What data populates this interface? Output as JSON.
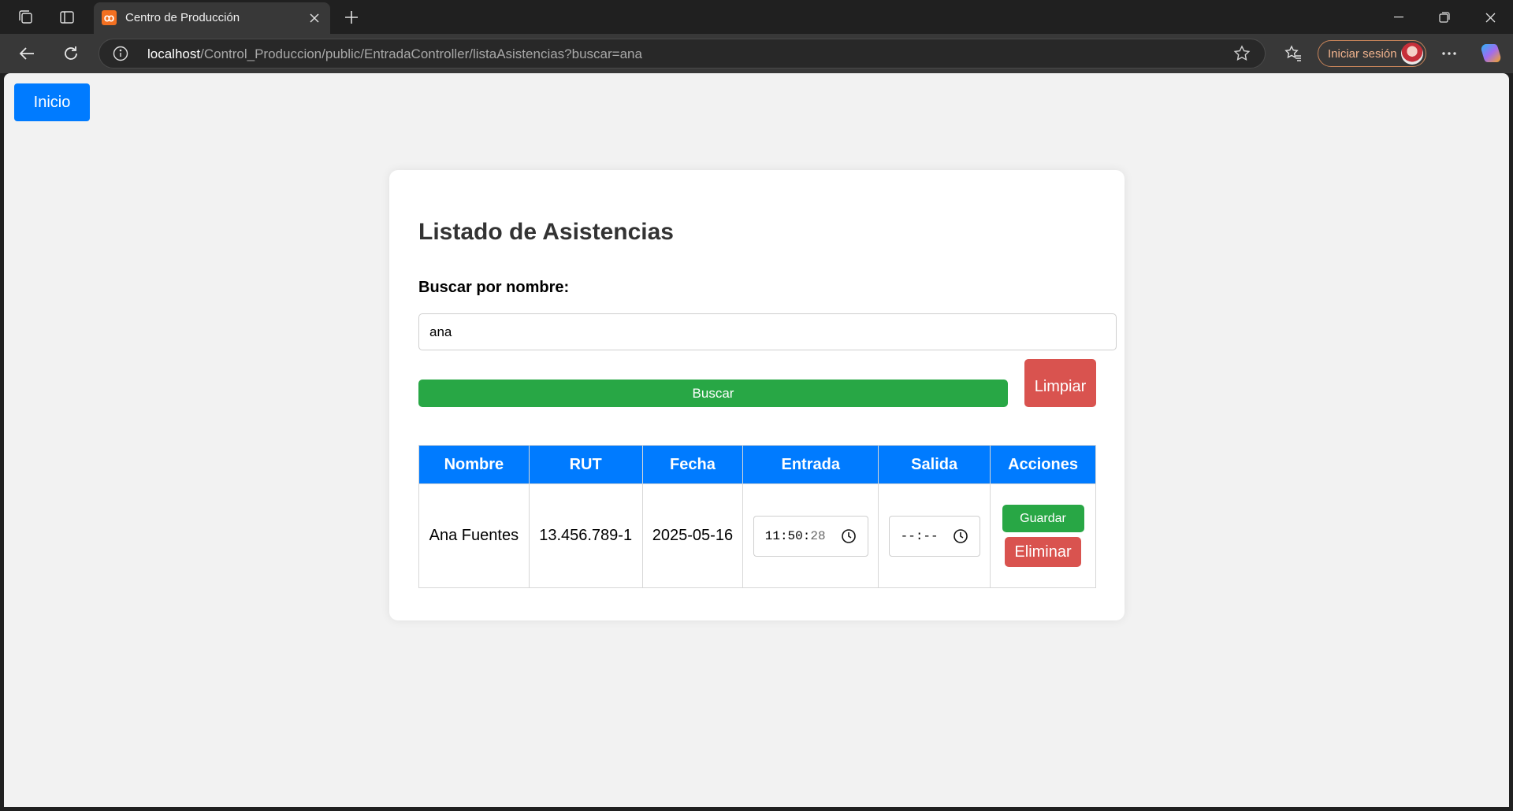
{
  "browser": {
    "tab_title": "Centro de Producción",
    "tab_favicon": "xampp-icon",
    "url_host": "localhost",
    "url_path": "/Control_Produccion/public/EntradaController/listaAsistencias?buscar=ana",
    "signin_label": "Iniciar sesión"
  },
  "page": {
    "home_button": "Inicio",
    "title": "Listado de Asistencias",
    "search_label": "Buscar por nombre:",
    "search_value": "ana",
    "search_button": "Buscar",
    "clear_button": "Limpiar",
    "columns": [
      "Nombre",
      "RUT",
      "Fecha",
      "Entrada",
      "Salida",
      "Acciones"
    ],
    "rows": [
      {
        "nombre": "Ana Fuentes",
        "rut": "13.456.789-1",
        "fecha": "2025-05-16",
        "entrada_hm": "11:50:",
        "entrada_s": "28",
        "salida": "--:--",
        "save_button": "Guardar",
        "delete_button": "Eliminar"
      }
    ]
  },
  "colors": {
    "primary": "#007bff",
    "success": "#28a745",
    "danger": "#d9534f"
  }
}
